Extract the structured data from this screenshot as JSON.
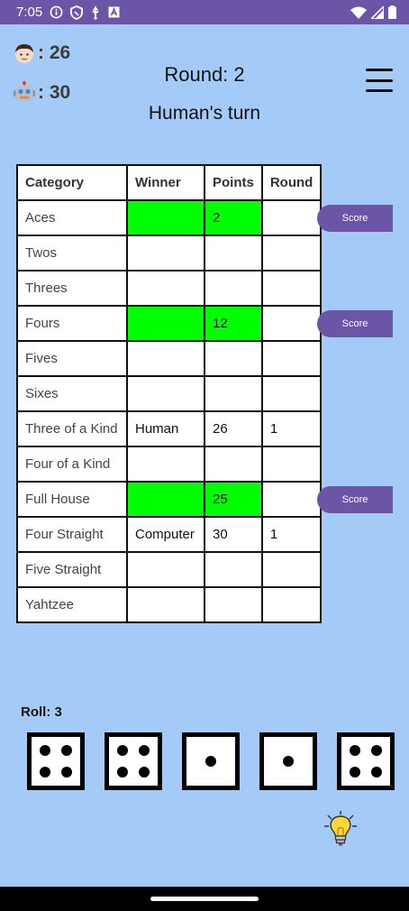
{
  "status_bar": {
    "time": "7:05",
    "left_icons": [
      "info-icon",
      "shield-icon",
      "usb-icon",
      "text-a-icon"
    ],
    "right_icons": [
      "wifi-icon",
      "cellular-signal-icon",
      "battery-icon"
    ]
  },
  "scores": {
    "human": {
      "avatar": "human-face-emoji",
      "label": ": 26"
    },
    "computer": {
      "avatar": "robot-emoji",
      "label": ": 30"
    }
  },
  "round_text": "Round: 2",
  "turn_text": "Human's turn",
  "table": {
    "headers": [
      "Category",
      "Winner",
      "Points",
      "Round"
    ],
    "rows": [
      {
        "category": "Aces",
        "winner": "",
        "points": "2",
        "round": "",
        "highlight": true,
        "score_button": "Score"
      },
      {
        "category": "Twos",
        "winner": "",
        "points": "",
        "round": "",
        "highlight": false
      },
      {
        "category": "Threes",
        "winner": "",
        "points": "",
        "round": "",
        "highlight": false
      },
      {
        "category": "Fours",
        "winner": "",
        "points": "12",
        "round": "",
        "highlight": true,
        "score_button": "Score"
      },
      {
        "category": "Fives",
        "winner": "",
        "points": "",
        "round": "",
        "highlight": false
      },
      {
        "category": "Sixes",
        "winner": "",
        "points": "",
        "round": "",
        "highlight": false
      },
      {
        "category": "Three of a Kind",
        "winner": "Human",
        "points": "26",
        "round": "1",
        "highlight": false
      },
      {
        "category": "Four of a Kind",
        "winner": "",
        "points": "",
        "round": "",
        "highlight": false
      },
      {
        "category": "Full House",
        "winner": "",
        "points": "25",
        "round": "",
        "highlight": true,
        "score_button": "Score"
      },
      {
        "category": "Four Straight",
        "winner": "Computer",
        "points": "30",
        "round": "1",
        "highlight": false
      },
      {
        "category": "Five Straight",
        "winner": "",
        "points": "",
        "round": "",
        "highlight": false
      },
      {
        "category": "Yahtzee",
        "winner": "",
        "points": "",
        "round": "",
        "highlight": false
      }
    ]
  },
  "roll_text": "Roll: 3",
  "dice": [
    4,
    4,
    1,
    1,
    4
  ],
  "colors": {
    "background": "#a4cbf7",
    "accent": "#6b55a7",
    "highlight": "#00ff00"
  },
  "hint_icon": "lightbulb-icon"
}
